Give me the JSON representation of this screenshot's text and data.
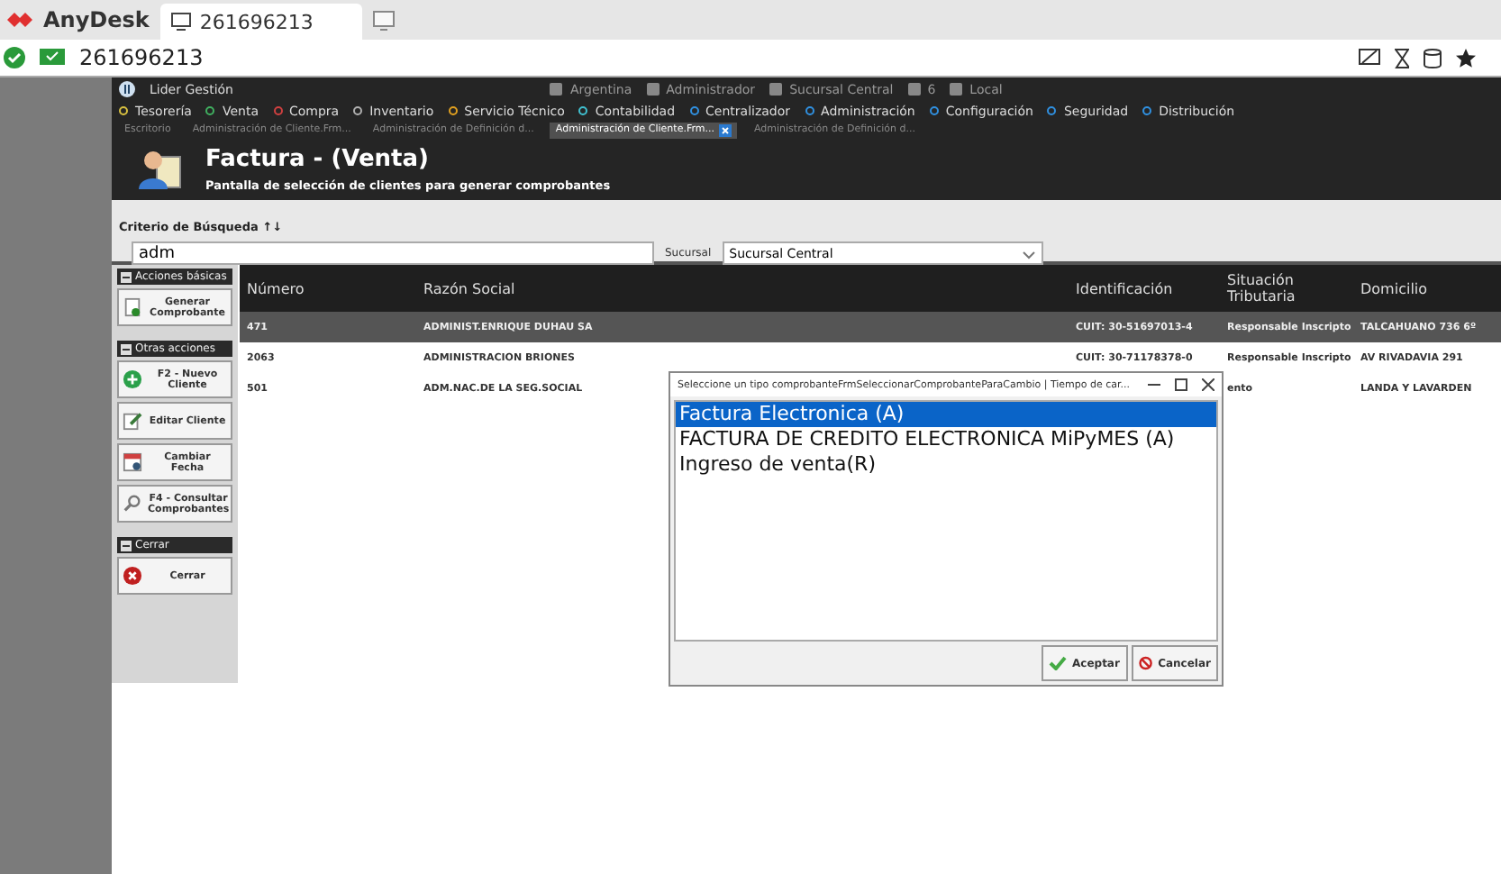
{
  "anydesk": {
    "brand": "AnyDesk",
    "session_tab": "261696213",
    "address": "261696213"
  },
  "app": {
    "title": "Lider Gestión",
    "status": [
      "Argentina",
      "Administrador",
      "Sucursal Central",
      "6",
      "Local"
    ],
    "menu": [
      {
        "label": "Tesorería",
        "color": "#d8c040"
      },
      {
        "label": "Venta",
        "color": "#40b060"
      },
      {
        "label": "Compra",
        "color": "#d04040"
      },
      {
        "label": "Inventario",
        "color": "#b0b0b0"
      },
      {
        "label": "Servicio Técnico",
        "color": "#e0a020"
      },
      {
        "label": "Contabilidad",
        "color": "#40c0d0"
      },
      {
        "label": "Centralizador",
        "color": "#3090e0"
      },
      {
        "label": "Administración",
        "color": "#3090e0"
      },
      {
        "label": "Configuración",
        "color": "#3090e0"
      },
      {
        "label": "Seguridad",
        "color": "#3090e0"
      },
      {
        "label": "Distribución",
        "color": "#3090e0"
      }
    ],
    "doc_tabs": [
      {
        "label": "Escritorio",
        "selected": false
      },
      {
        "label": "Administración de Cliente.Frm...",
        "selected": false
      },
      {
        "label": "Administración de Definición d...",
        "selected": false
      },
      {
        "label": "Administración de Cliente.Frm...",
        "selected": true
      },
      {
        "label": "Administración de Definición d...",
        "selected": false
      }
    ]
  },
  "form": {
    "title": "Factura - (Venta)",
    "subtitle": "Pantalla de selección de clientes para generar comprobantes",
    "criteria_label": "Criterio de Búsqueda ↑↓",
    "search_value": "adm",
    "branch_label": "Sucursal",
    "branch_value": "Sucursal Central"
  },
  "sidebar": [
    {
      "header": "Acciones básicas",
      "buttons": [
        {
          "label": "Generar Comprobante",
          "kind": "doc"
        }
      ]
    },
    {
      "header": "Otras acciones",
      "buttons": [
        {
          "label": "F2 - Nuevo Cliente",
          "kind": "add"
        },
        {
          "label": "Editar Cliente",
          "kind": "edit"
        },
        {
          "label": "Cambiar Fecha",
          "kind": "calendar"
        },
        {
          "label": "F4 - Consultar Comprobantes",
          "kind": "search"
        }
      ]
    },
    {
      "header": "Cerrar",
      "buttons": [
        {
          "label": "Cerrar",
          "kind": "close"
        }
      ]
    }
  ],
  "table": {
    "columns": [
      "Número",
      "Razón Social",
      "Identificación",
      "Situación Tributaria",
      "Domicilio"
    ],
    "rows": [
      {
        "selected": true,
        "cells": [
          "471",
          "ADMINIST.ENRIQUE DUHAU SA",
          "CUIT: 30-51697013-4",
          "Responsable Inscripto",
          "TALCAHUANO 736 6º"
        ]
      },
      {
        "selected": false,
        "cells": [
          "2063",
          "ADMINISTRACION BRIONES",
          "CUIT: 30-71178378-0",
          "Responsable Inscripto",
          "AV RIVADAVIA 291"
        ]
      },
      {
        "selected": false,
        "cells": [
          "501",
          "ADM.NAC.DE LA SEG.SOCIAL",
          "",
          "ento",
          "LANDA Y LAVARDEN"
        ]
      }
    ]
  },
  "dialog": {
    "title": "Seleccione un tipo comprobanteFrmSeleccionarComprobanteParaCambio | Tiempo de car...",
    "items": [
      {
        "label": "Factura Electronica (A)",
        "selected": true
      },
      {
        "label": "FACTURA DE CREDITO ELECTRONICA MiPyMES (A)",
        "selected": false
      },
      {
        "label": "Ingreso de venta(R)",
        "selected": false
      }
    ],
    "accept": "Aceptar",
    "cancel": "Cancelar"
  }
}
